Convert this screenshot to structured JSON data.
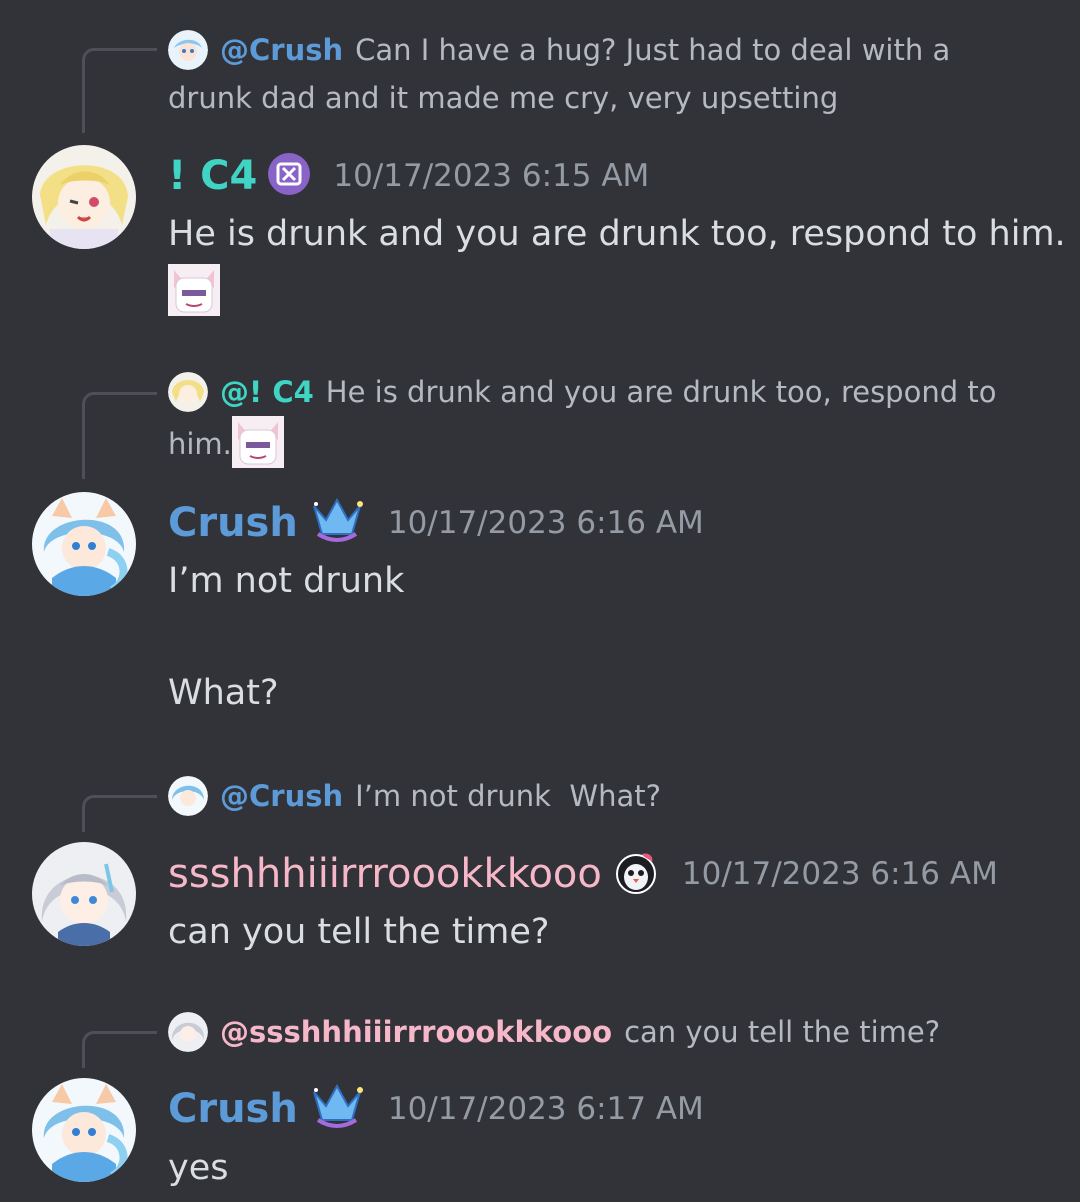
{
  "messages": [
    {
      "reply": {
        "mention": "@Crush",
        "text": "Can I have a hug? Just had to deal with a drunk dad and it made me cry, very upsetting"
      },
      "author": "! C4",
      "timestamp": "10/17/2023 6:15 AM",
      "body": "He is drunk and you are drunk too, respond to him."
    },
    {
      "reply": {
        "mention": "@! C4",
        "text": "He is drunk and you are drunk too, respond to",
        "text2": "him."
      },
      "author": "Crush",
      "timestamp": "10/17/2023 6:16 AM",
      "body_lines": [
        "I’m not drunk",
        "What?"
      ]
    },
    {
      "reply": {
        "mention": "@Crush",
        "text": "I’m not drunk  What?"
      },
      "author": "ssshhhiiirrroookkkooo",
      "timestamp": "10/17/2023 6:16 AM",
      "body": "can you tell the time?"
    },
    {
      "reply": {
        "mention": "@ssshhhiiirrroookkkooo",
        "text": "can you tell the time?"
      },
      "author": "Crush",
      "timestamp": "10/17/2023 6:17 AM",
      "body": "yes"
    }
  ],
  "colors": {
    "background": "#313338",
    "mention_blue": "#5c9ad8",
    "mention_teal": "#3fd4c4",
    "username_pink": "#f6b8c8",
    "timestamp": "#949ba4"
  },
  "icons": [
    "avatar-blonde-girl",
    "avatar-blue-hair-girl",
    "avatar-silver-hair-girl",
    "badge-purple-x-icon",
    "badge-crown-trident-icon",
    "badge-penguin-icon",
    "sticker-cat-girl-emoji"
  ]
}
